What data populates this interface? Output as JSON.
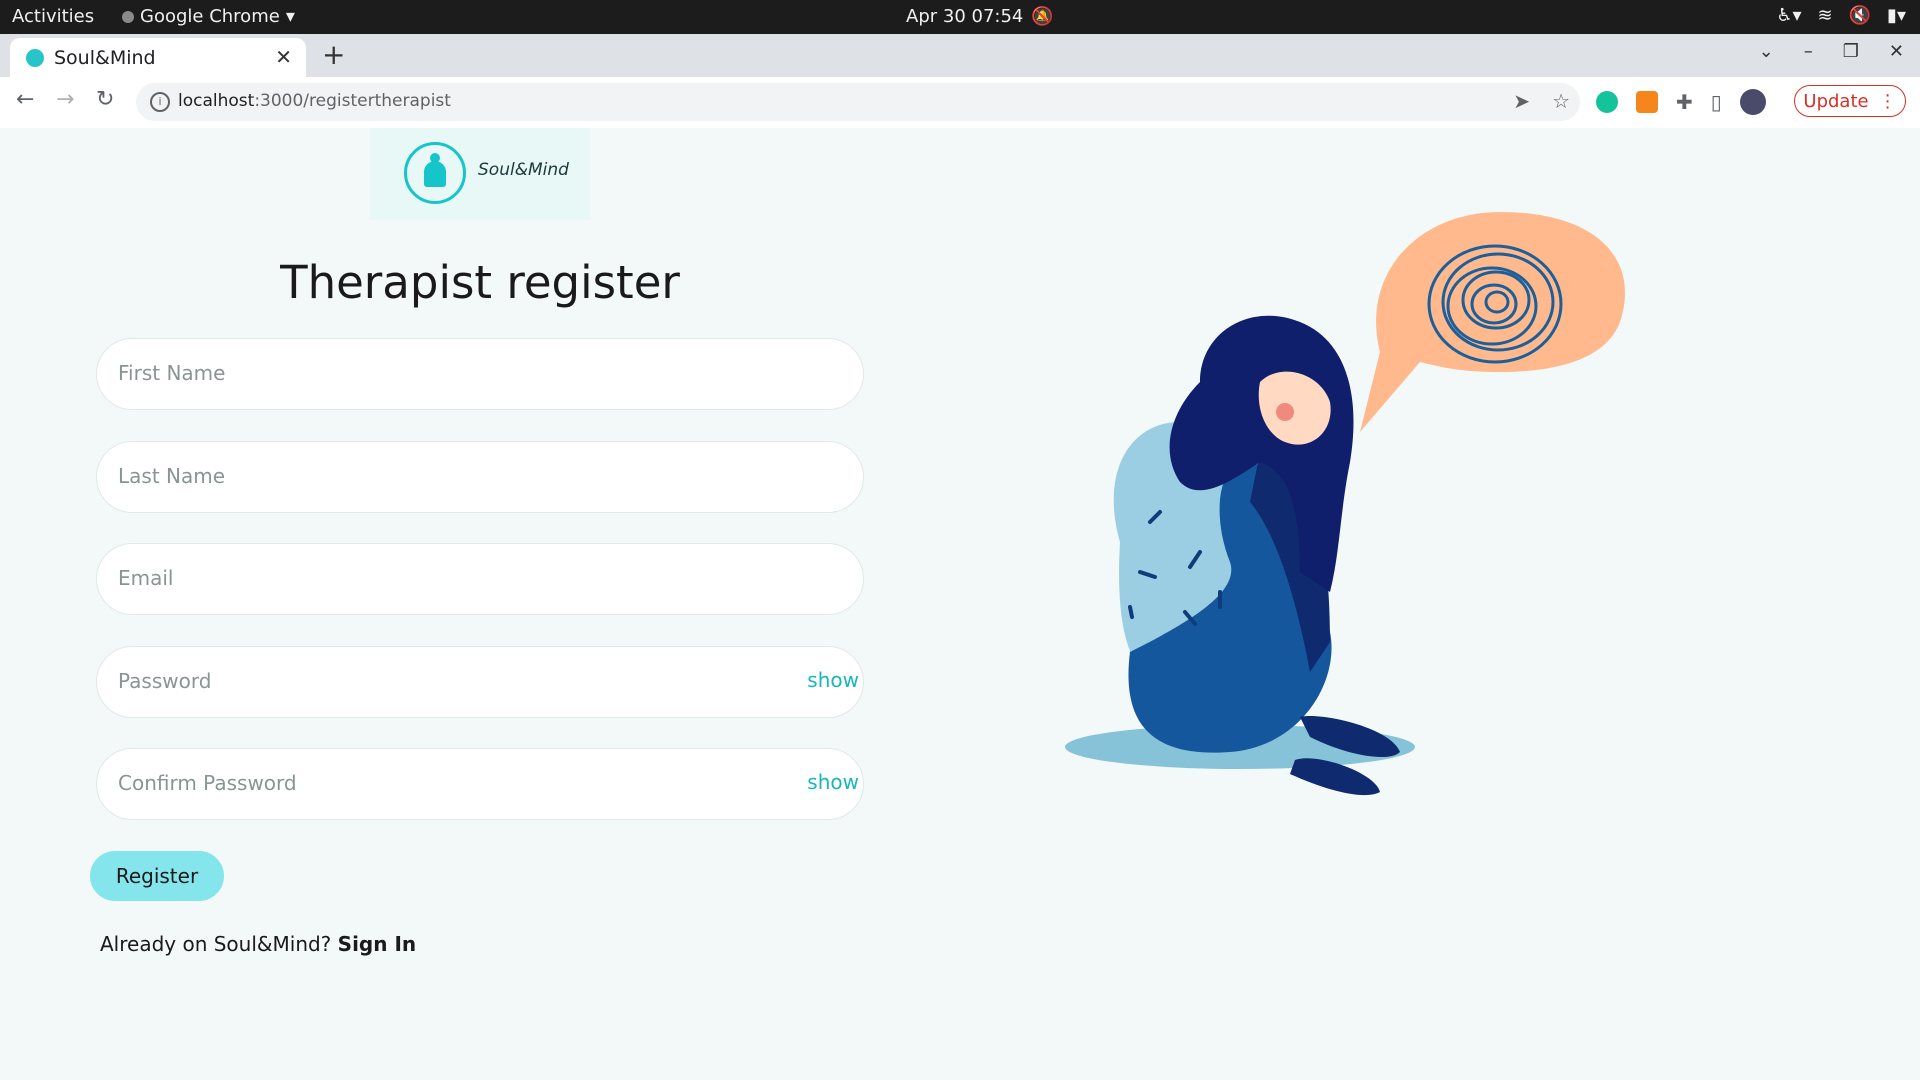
{
  "system": {
    "activities": "Activities",
    "app_name": "Google Chrome",
    "clock": "Apr 30  07:54"
  },
  "browser": {
    "tab_title": "Soul&Mind",
    "url_host": "localhost",
    "url_path": ":3000/registertherapist",
    "update_label": "Update"
  },
  "page": {
    "brand": "Soul&Mind",
    "heading": "Therapist register",
    "fields": {
      "first_name": "First Name",
      "last_name": "Last Name",
      "email": "Email",
      "password": "Password",
      "confirm_password": "Confirm Password"
    },
    "show_label": "show",
    "register_label": "Register",
    "already_text": "Already on Soul&Mind?",
    "sign_in_label": "Sign In"
  },
  "colors": {
    "accent": "#15c5c9",
    "register_button": "#84e6ec",
    "bubble": "#ffb98c"
  }
}
